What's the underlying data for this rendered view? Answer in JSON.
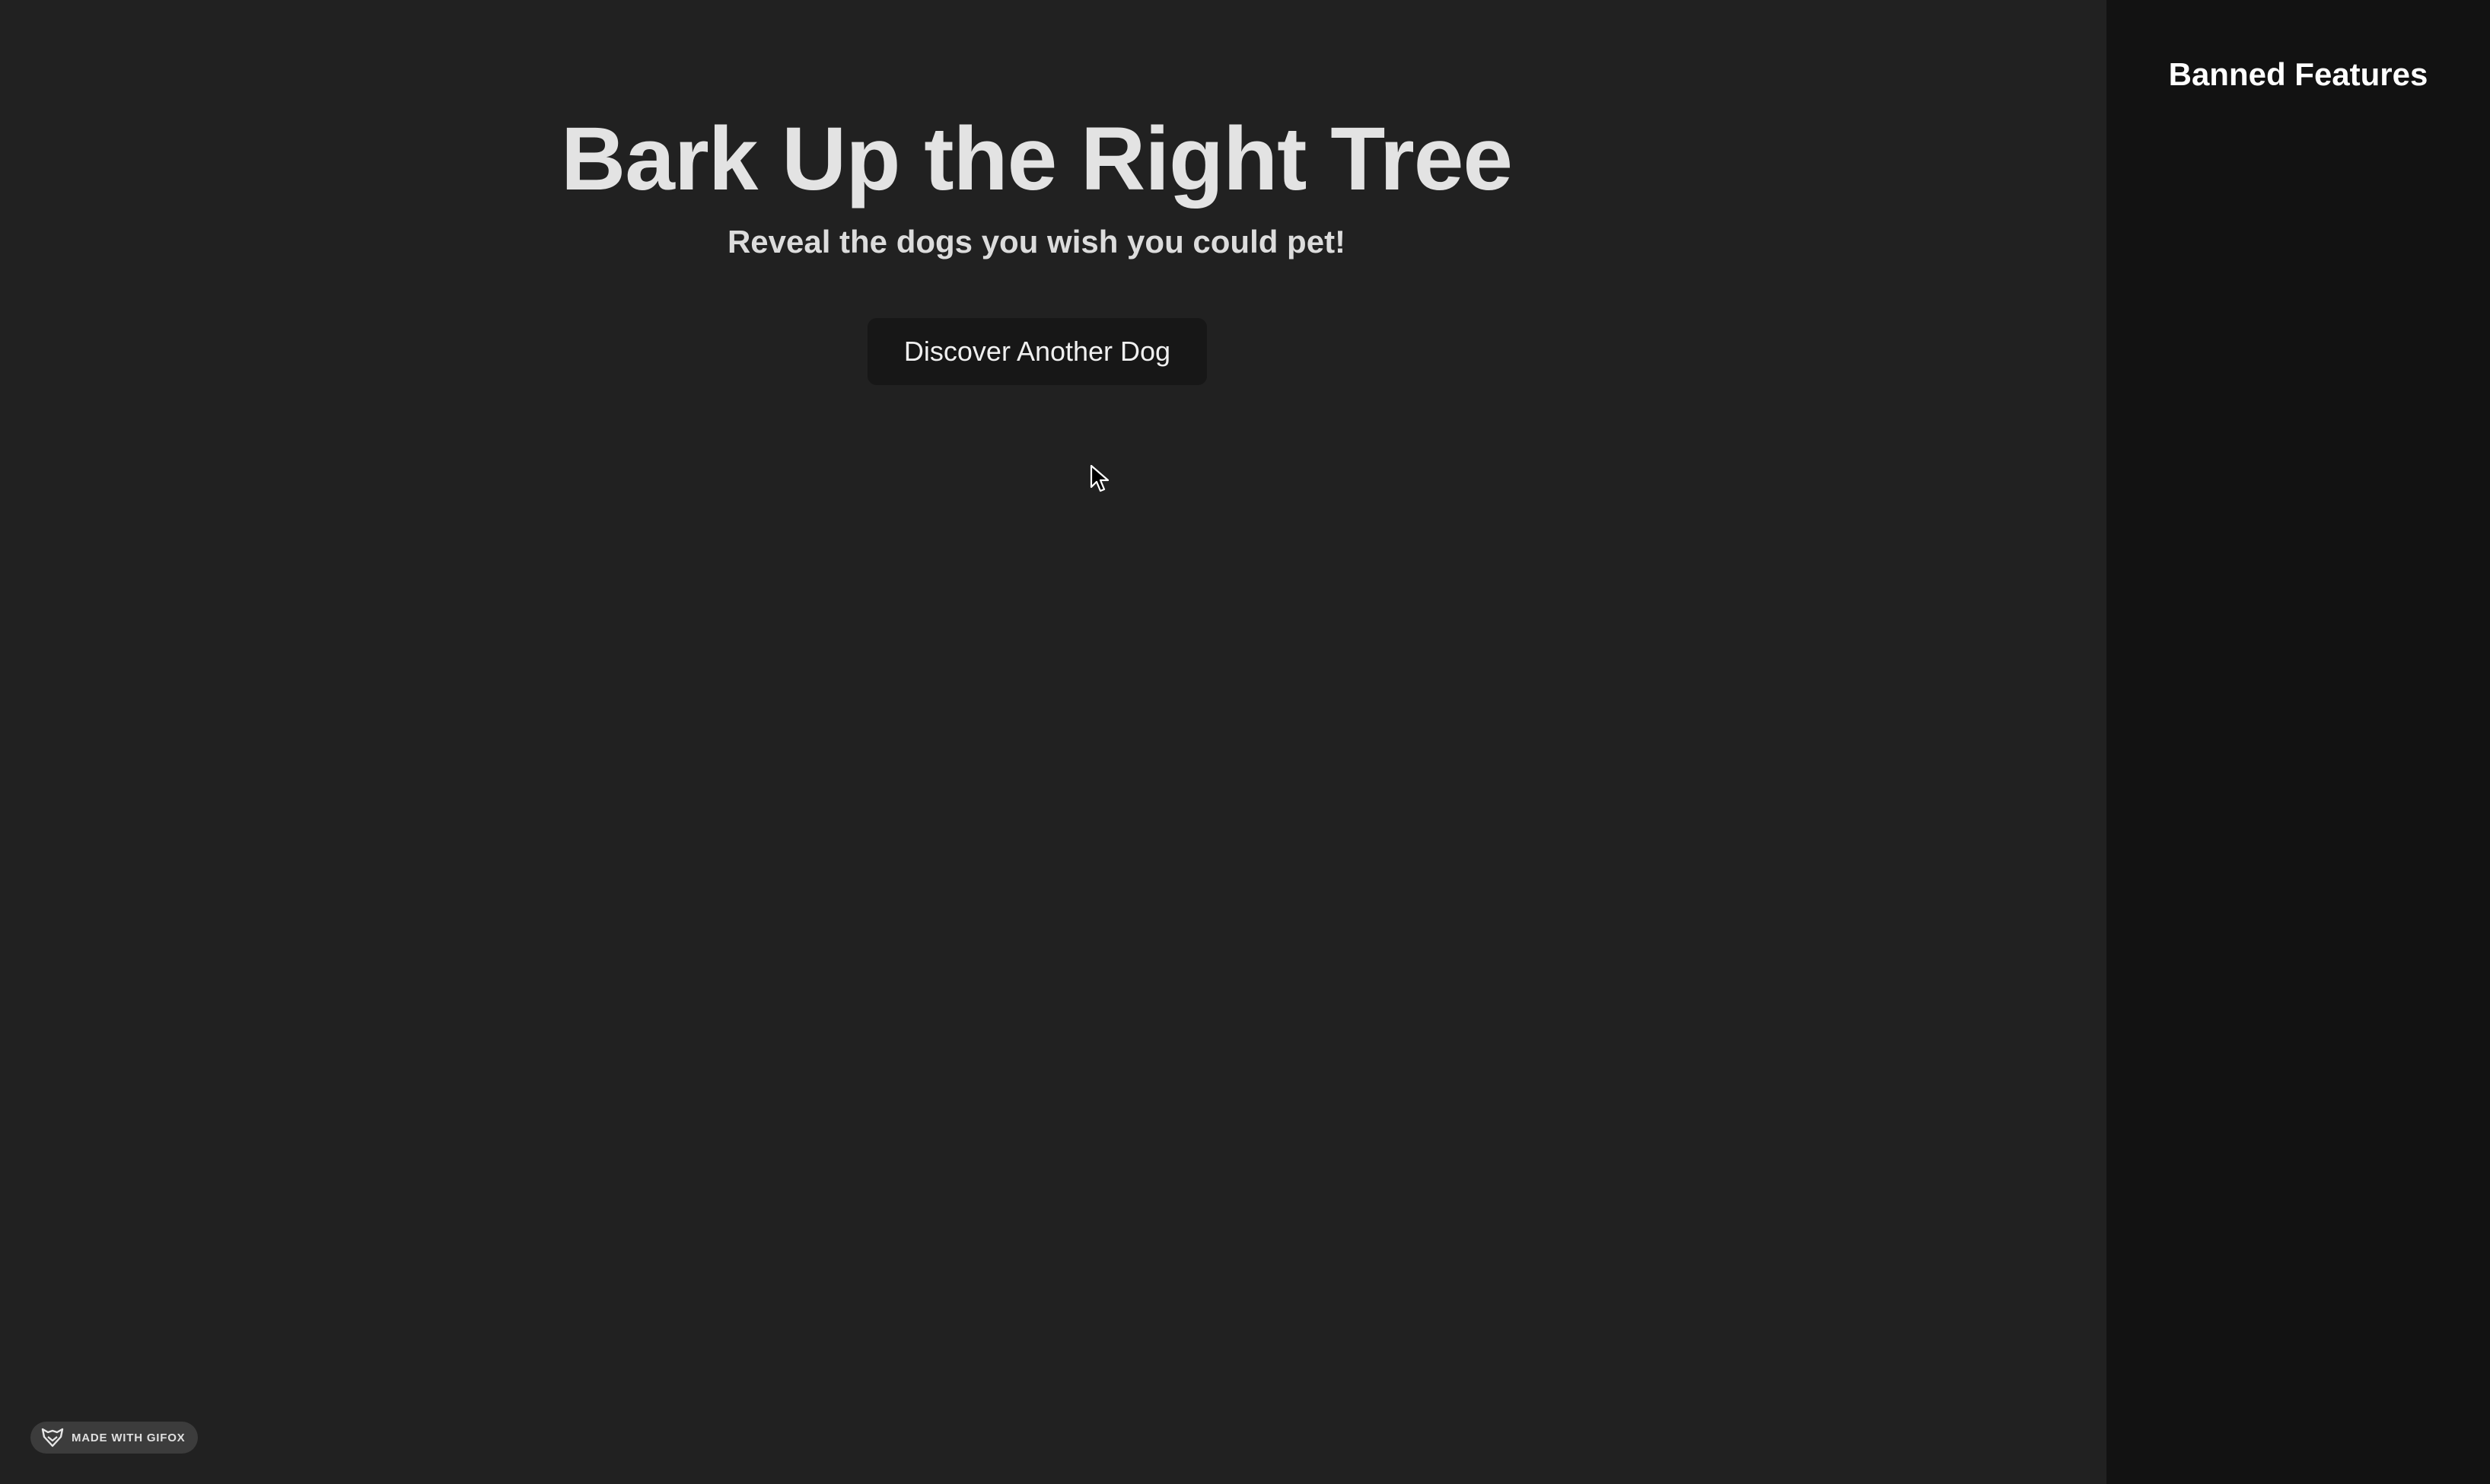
{
  "header": {
    "title": "Bark Up the Right Tree",
    "subtitle": "Reveal the dogs you wish you could pet!"
  },
  "actions": {
    "discover_label": "Discover Another Dog"
  },
  "sidebar": {
    "title": "Banned Features"
  },
  "watermark": {
    "label": "MADE WITH GIFOX",
    "icon": "fox-icon"
  },
  "colors": {
    "main_background": "#212121",
    "sidebar_background": "#121212",
    "button_background": "#171717",
    "title_text": "#e3e3e3"
  }
}
